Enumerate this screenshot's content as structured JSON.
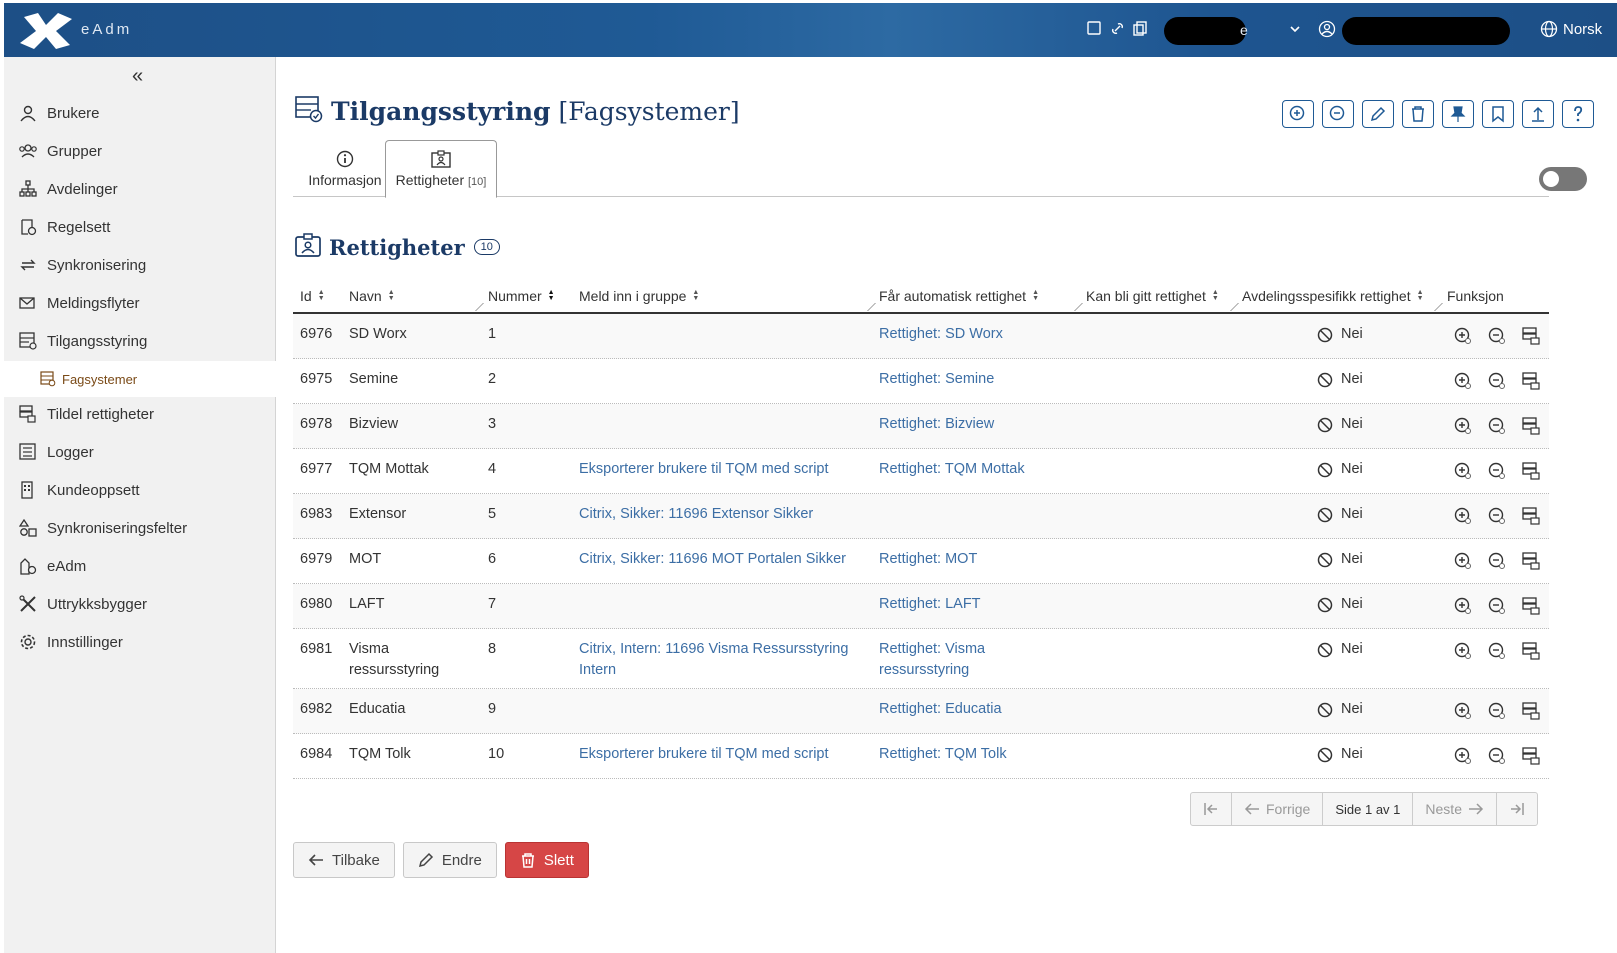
{
  "header": {
    "app_name": "eAdm",
    "middle_text": "e",
    "language": "Norsk",
    "icons": [
      "note-icon",
      "link-icon",
      "copy-icon",
      "chevron-down-icon",
      "user-circle-icon",
      "globe-icon"
    ]
  },
  "sidebar": {
    "collapse_icon": "«",
    "items": [
      {
        "label": "Brukere",
        "icon": "user-icon"
      },
      {
        "label": "Grupper",
        "icon": "group-icon"
      },
      {
        "label": "Avdelinger",
        "icon": "org-chart-icon"
      },
      {
        "label": "Regelsett",
        "icon": "ruleset-icon"
      },
      {
        "label": "Synkronisering",
        "icon": "sync-icon"
      },
      {
        "label": "Meldingsflyter",
        "icon": "mail-flow-icon"
      },
      {
        "label": "Tilgangsstyring",
        "icon": "access-control-icon"
      },
      {
        "label": "Fagsystemer",
        "icon": "systems-icon"
      },
      {
        "label": "Tildel rettigheter",
        "icon": "assign-icon"
      },
      {
        "label": "Logger",
        "icon": "log-icon"
      },
      {
        "label": "Kundeoppsett",
        "icon": "building-icon"
      },
      {
        "label": "Synkroniseringsfelter",
        "icon": "shapes-icon"
      },
      {
        "label": "eAdm",
        "icon": "eadm-icon"
      },
      {
        "label": "Uttrykksbygger",
        "icon": "tools-icon"
      },
      {
        "label": "Innstillinger",
        "icon": "gear-icon"
      }
    ]
  },
  "page": {
    "title": "Tilgangsstyring",
    "subtitle": "[Fagsystemer]",
    "tabs": [
      {
        "label": "Informasjon",
        "count": ""
      },
      {
        "label": "Rettigheter",
        "count": "[10]"
      }
    ],
    "section_title": "Rettigheter",
    "section_count": "10"
  },
  "table": {
    "columns": [
      "Id",
      "Navn",
      "Nummer",
      "Meld inn i gruppe",
      "Får automatisk rettighet",
      "Kan bli gitt rettighet",
      "Avdelingsspesifikk rettighet",
      "Funksjon"
    ],
    "rows": [
      {
        "id": "6976",
        "navn": "SD Worx",
        "nummer": "1",
        "gruppe": "",
        "auto": "Rettighet: SD Worx",
        "kan": "",
        "avd": "Nei"
      },
      {
        "id": "6975",
        "navn": "Semine",
        "nummer": "2",
        "gruppe": "",
        "auto": "Rettighet: Semine",
        "kan": "",
        "avd": "Nei"
      },
      {
        "id": "6978",
        "navn": "Bizview",
        "nummer": "3",
        "gruppe": "",
        "auto": "Rettighet: Bizview",
        "kan": "",
        "avd": "Nei"
      },
      {
        "id": "6977",
        "navn": "TQM Mottak",
        "nummer": "4",
        "gruppe": "Eksporterer brukere til TQM med script",
        "auto": "Rettighet: TQM Mottak",
        "kan": "",
        "avd": "Nei"
      },
      {
        "id": "6983",
        "navn": "Extensor",
        "nummer": "5",
        "gruppe": "Citrix, Sikker: 11696 Extensor Sikker",
        "auto": "",
        "kan": "",
        "avd": "Nei"
      },
      {
        "id": "6979",
        "navn": "MOT",
        "nummer": "6",
        "gruppe": "Citrix, Sikker: 11696 MOT Portalen Sikker",
        "auto": "Rettighet: MOT",
        "kan": "",
        "avd": "Nei"
      },
      {
        "id": "6980",
        "navn": "LAFT",
        "nummer": "7",
        "gruppe": "",
        "auto": "Rettighet: LAFT",
        "kan": "",
        "avd": "Nei"
      },
      {
        "id": "6981",
        "navn": "Visma ressursstyring",
        "nummer": "8",
        "gruppe": "Citrix, Intern: 11696 Visma Ressursstyring Intern",
        "auto": "Rettighet: Visma ressursstyring",
        "kan": "",
        "avd": "Nei"
      },
      {
        "id": "6982",
        "navn": "Educatia",
        "nummer": "9",
        "gruppe": "",
        "auto": "Rettighet: Educatia",
        "kan": "",
        "avd": "Nei"
      },
      {
        "id": "6984",
        "navn": "TQM Tolk",
        "nummer": "10",
        "gruppe": "Eksporterer brukere til TQM med script",
        "auto": "Rettighet: TQM Tolk",
        "kan": "",
        "avd": "Nei"
      }
    ]
  },
  "pagination": {
    "prev": "Forrige",
    "page_info": "Side 1 av 1",
    "next": "Neste"
  },
  "buttons": {
    "back": "Tilbake",
    "edit": "Endre",
    "delete": "Slett"
  },
  "colors": {
    "brand": "#1d4f86",
    "link": "#3c6ea5",
    "danger": "#d64646",
    "sub_item": "#7a4a17"
  }
}
